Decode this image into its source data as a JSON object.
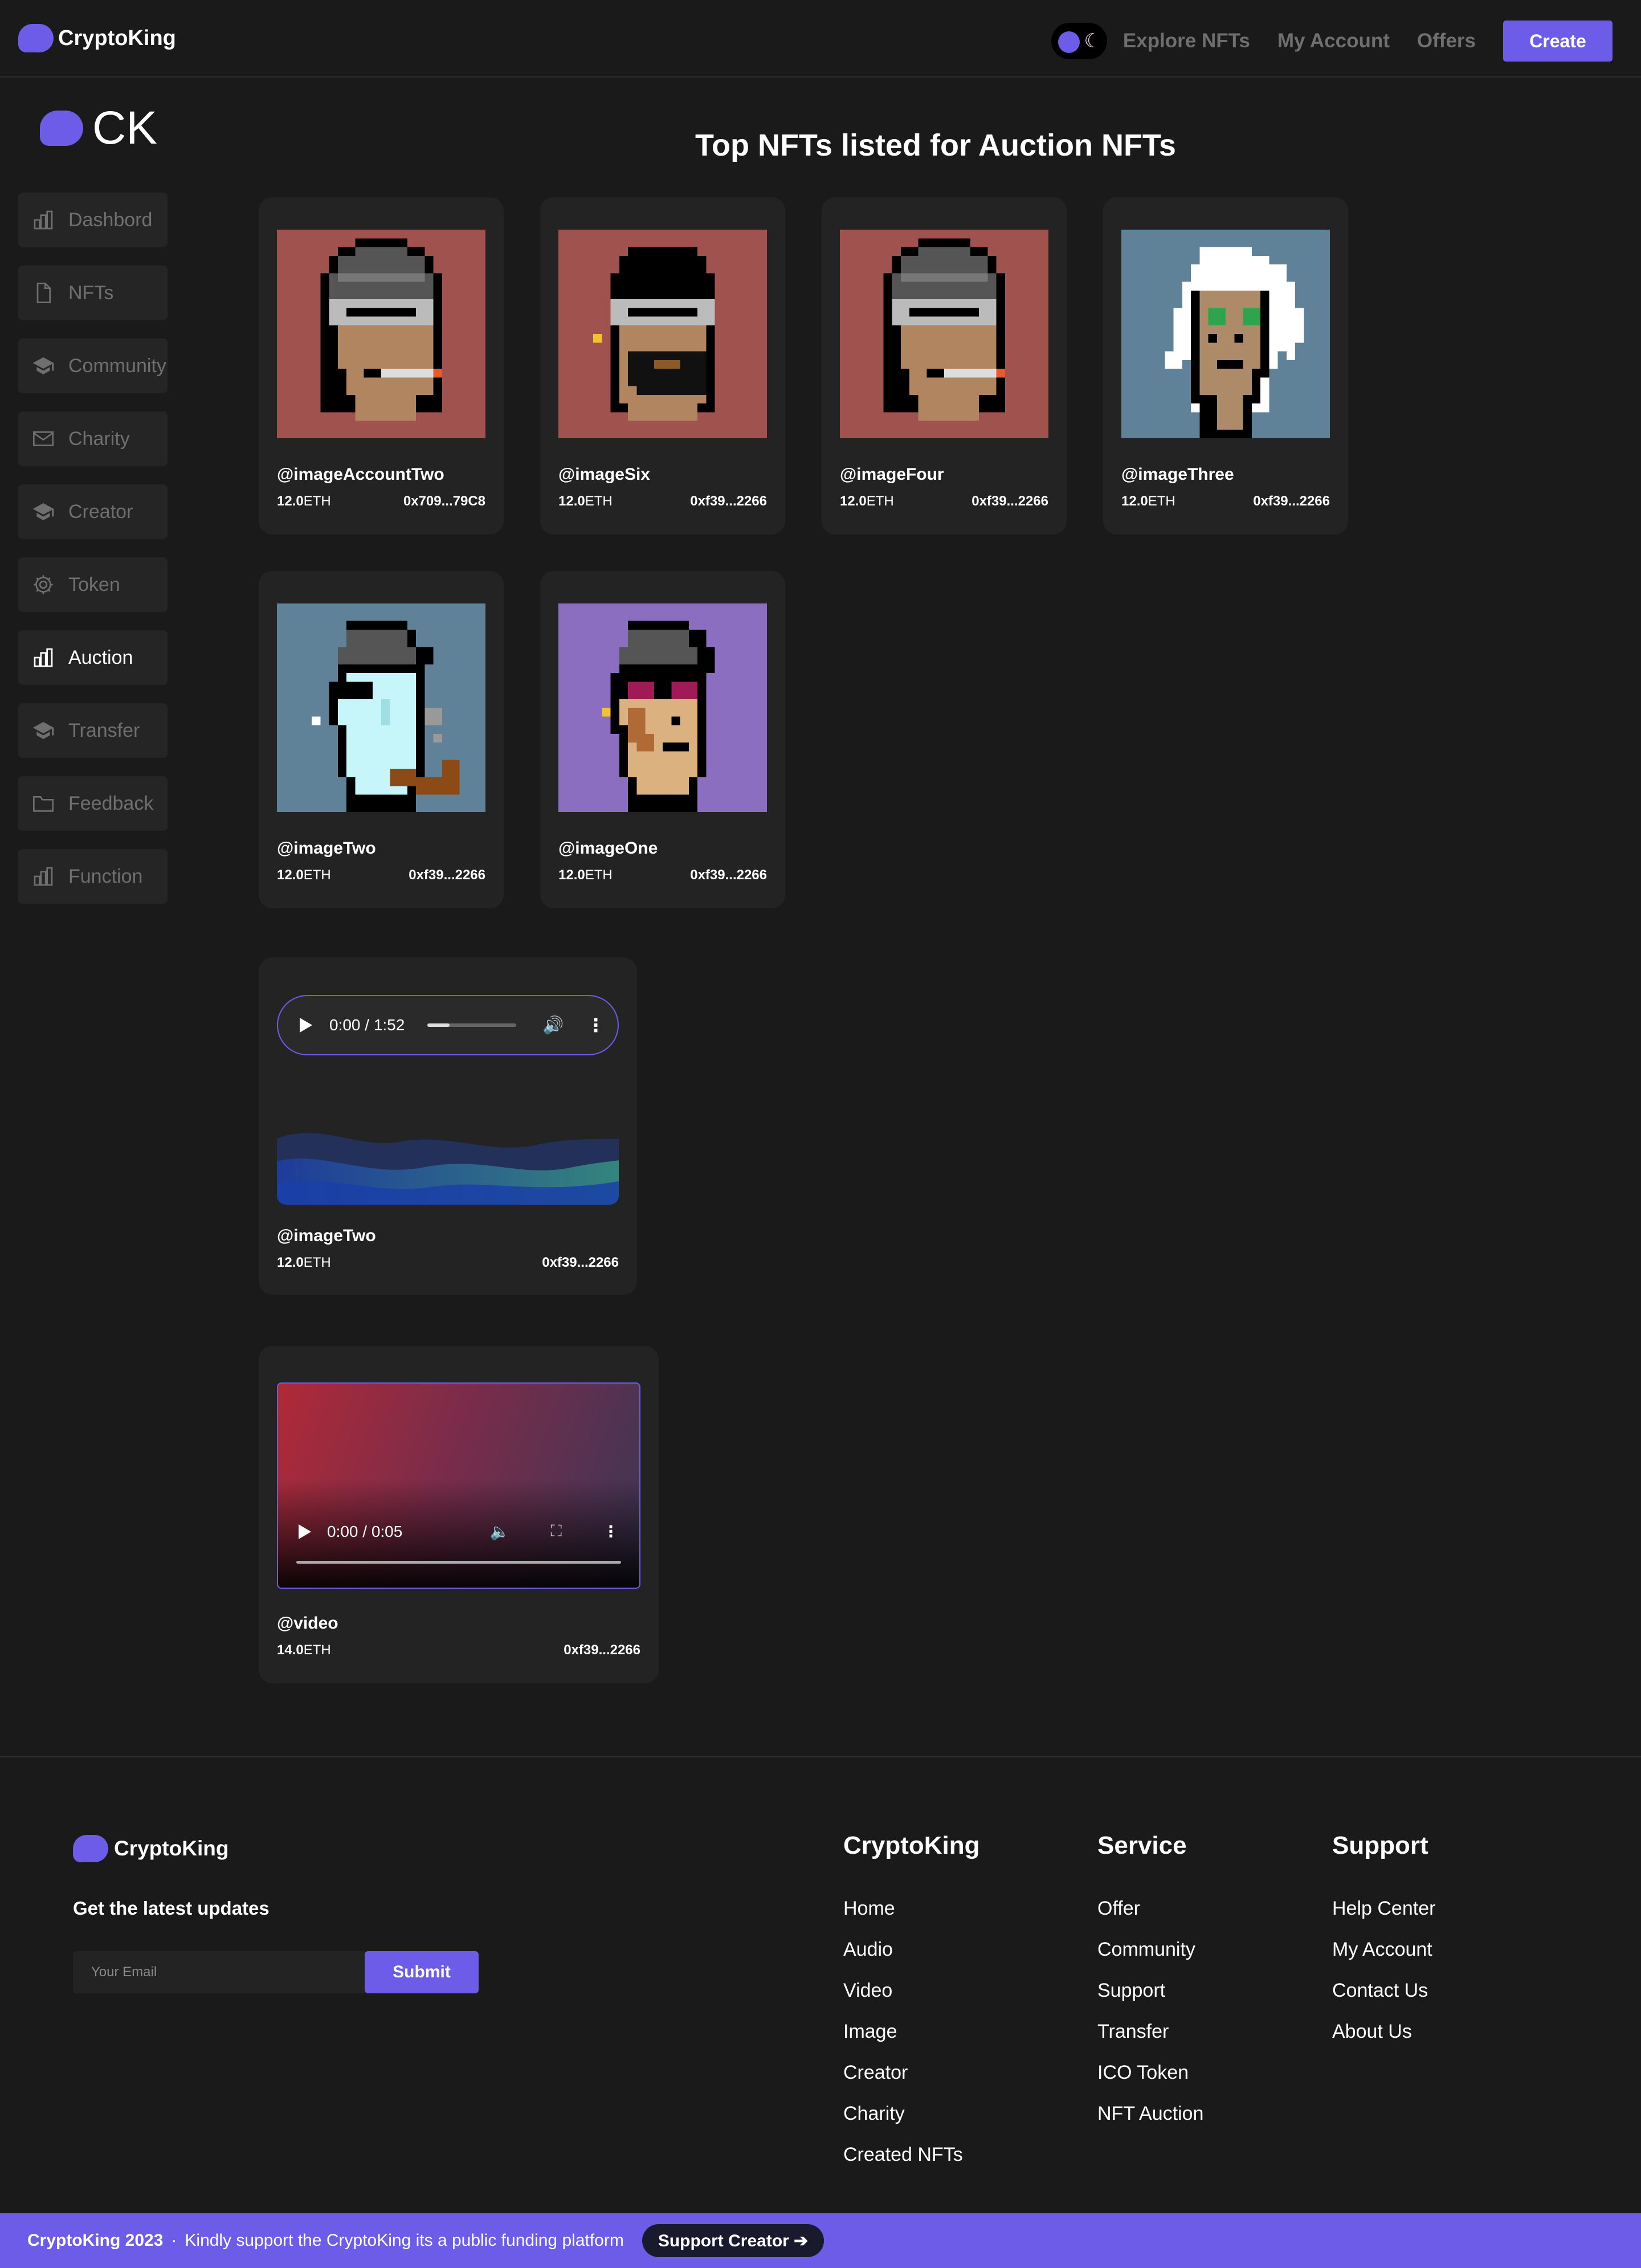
{
  "header": {
    "brand": "CryptoKing",
    "nav": [
      "Explore NFTs",
      "My Account",
      "Offers"
    ],
    "create_label": "Create",
    "moon_glyph": "☾"
  },
  "sidebar": {
    "logo_text": "CK",
    "items": [
      {
        "label": "Dashbord",
        "icon": "bar-chart-icon"
      },
      {
        "label": "NFTs",
        "icon": "file-icon"
      },
      {
        "label": "Community",
        "icon": "graduation-cap-icon"
      },
      {
        "label": "Charity",
        "icon": "mail-icon"
      },
      {
        "label": "Creator",
        "icon": "graduation-cap-icon"
      },
      {
        "label": "Token",
        "icon": "gear-icon"
      },
      {
        "label": "Auction",
        "icon": "bar-chart-icon"
      },
      {
        "label": "Transfer",
        "icon": "graduation-cap-icon"
      },
      {
        "label": "Feedback",
        "icon": "folder-icon"
      },
      {
        "label": "Function",
        "icon": "bar-chart-icon"
      }
    ],
    "active": "Auction"
  },
  "main": {
    "title": "Top NFTs listed for Auction NFTs",
    "nfts": [
      {
        "name": "@imageAccountTwo",
        "price": "12.0",
        "unit": "ETH",
        "address": "0x709...79C8"
      },
      {
        "name": "@imageSix",
        "price": "12.0",
        "unit": "ETH",
        "address": "0xf39...2266"
      },
      {
        "name": "@imageFour",
        "price": "12.0",
        "unit": "ETH",
        "address": "0xf39...2266"
      },
      {
        "name": "@imageThree",
        "price": "12.0",
        "unit": "ETH",
        "address": "0xf39...2266"
      },
      {
        "name": "@imageTwo",
        "price": "12.0",
        "unit": "ETH",
        "address": "0xf39...2266"
      },
      {
        "name": "@imageOne",
        "price": "12.0",
        "unit": "ETH",
        "address": "0xf39...2266"
      }
    ],
    "audio": {
      "time": "0:00 / 1:52",
      "progress": 0.25,
      "name": "@imageTwo",
      "price": "12.0",
      "unit": "ETH",
      "address": "0xf39...2266"
    },
    "video": {
      "time": "0:00 / 0:05",
      "name": "@video",
      "price": "14.0",
      "unit": "ETH",
      "address": "0xf39...2266"
    }
  },
  "footer": {
    "brand": "CryptoKing",
    "updates_heading": "Get the latest updates",
    "email_placeholder": "Your Email",
    "submit_label": "Submit",
    "columns": [
      {
        "title": "CryptoKing",
        "links": [
          "Home",
          "Audio",
          "Video",
          "Image",
          "Creator",
          "Charity",
          "Created NFTs"
        ]
      },
      {
        "title": "Service",
        "links": [
          "Offer",
          "Community",
          "Support",
          "Transfer",
          "ICO Token",
          "NFT Auction"
        ]
      },
      {
        "title": "Support",
        "links": [
          "Help Center",
          "My Account",
          "Contact Us",
          "About Us"
        ]
      }
    ],
    "bottom": {
      "copyright": "CryptoKing 2023",
      "separator": "·",
      "message": "Kindly support the CryptoKing its a public funding platform",
      "button_label": "Support Creator ➔"
    }
  },
  "colors": {
    "accent": "#6c5ce7",
    "background": "#1a1a1a",
    "card": "#232323"
  }
}
